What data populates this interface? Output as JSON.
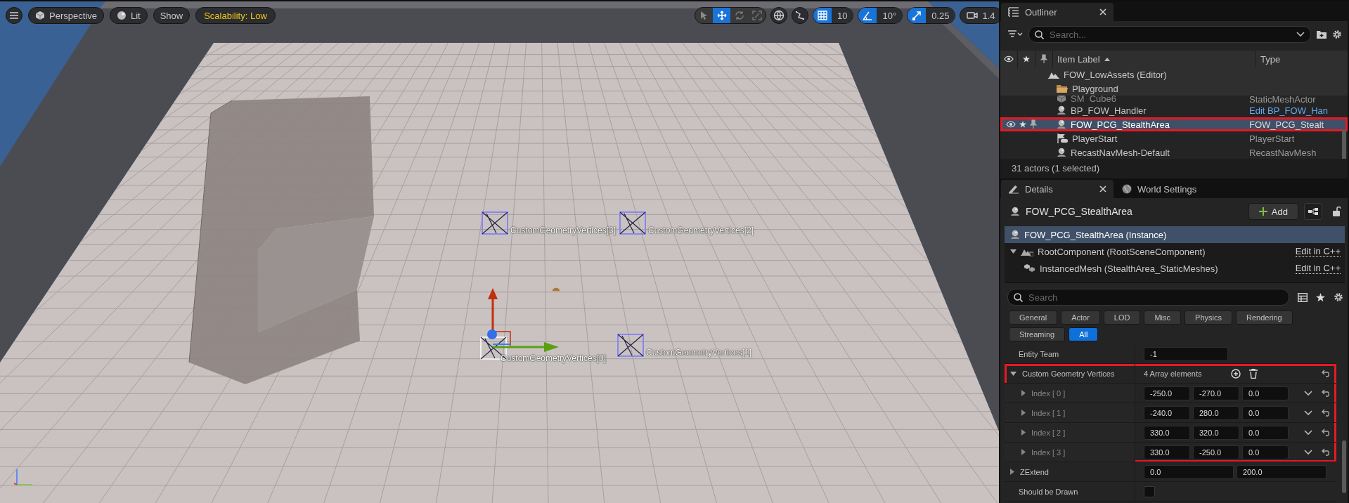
{
  "viewport": {
    "toolbar_left": [
      {
        "kind": "perspective",
        "label": "Perspective"
      },
      {
        "kind": "lit",
        "label": "Lit"
      },
      {
        "kind": "plain",
        "label": "Show"
      },
      {
        "kind": "warning",
        "label": "Scalability: Low"
      }
    ],
    "transform_tools": [
      {
        "kind": "select",
        "selected": false
      },
      {
        "kind": "move",
        "selected": true
      },
      {
        "kind": "rotate",
        "selected": false
      },
      {
        "kind": "scale",
        "selected": false
      }
    ],
    "snaps": [
      {
        "kind": "grid",
        "value": "10",
        "on": true
      },
      {
        "kind": "angle",
        "value": "10°",
        "on": true
      },
      {
        "kind": "scale",
        "value": "0.25",
        "on": true
      }
    ],
    "camera_speed": "1.4",
    "vertex_labels": [
      {
        "text": "CustomGeometryVertices[3]",
        "selected": false
      },
      {
        "text": "CustomGeometryVertices[2]",
        "selected": false
      },
      {
        "text": "CustomGeometryVertices[0]",
        "selected": true
      },
      {
        "text": "CustomGeometryVertices[1]",
        "selected": false
      }
    ]
  },
  "outliner": {
    "title": "Outliner",
    "search": {
      "placeholder": "Search..."
    },
    "columns": [
      "Item Label",
      "Type"
    ],
    "rows": [
      {
        "kind": "level",
        "label": "FOW_LowAssets (Editor)",
        "selected": false,
        "highlighted": false
      },
      {
        "kind": "folder",
        "label": "Playground",
        "selected": false,
        "highlighted": false
      },
      {
        "kind": "mesh",
        "label": "SM_Cube6",
        "type": "StaticMeshActor",
        "type_link": false,
        "selected": false,
        "highlighted": false
      },
      {
        "kind": "actor",
        "label": "BP_FOW_Handler",
        "type": "Edit BP_FOW_Han",
        "type_link": true,
        "selected": false,
        "highlighted": false
      },
      {
        "kind": "actor",
        "label": "FOW_PCG_StealthArea",
        "type": "FOW_PCG_Stealt",
        "type_link": false,
        "selected": true,
        "highlighted": true
      },
      {
        "kind": "playerstart",
        "label": "PlayerStart",
        "type": "PlayerStart",
        "type_link": false,
        "selected": false,
        "highlighted": false
      },
      {
        "kind": "actor",
        "label": "RecastNavMesh-Default",
        "type": "RecastNavMesh",
        "type_link": false,
        "selected": false,
        "highlighted": false
      }
    ],
    "status": "31 actors (1 selected)"
  },
  "details": {
    "tabs": [
      {
        "kind": "details",
        "label": "Details",
        "selected": true
      },
      {
        "kind": "world",
        "label": "World Settings",
        "selected": false
      }
    ],
    "actor_name": "FOW_PCG_StealthArea",
    "add_label": "Add",
    "components": [
      {
        "kind": "actor",
        "label": "FOW_PCG_StealthArea (Instance)",
        "selected": true
      },
      {
        "kind": "scene",
        "label": "RootComponent (RootSceneComponent)",
        "action": "Edit in C++",
        "selected": false,
        "expanded": true,
        "children": [
          {
            "kind": "mesh",
            "label": "InstancedMesh (StealthArea_StaticMeshes)",
            "action": "Edit in C++",
            "selected": false
          }
        ]
      }
    ],
    "search": {
      "placeholder": "Search"
    },
    "filters": [
      {
        "label": "General",
        "selected": false
      },
      {
        "label": "Actor",
        "selected": false
      },
      {
        "label": "LOD",
        "selected": false
      },
      {
        "label": "Misc",
        "selected": false
      },
      {
        "label": "Physics",
        "selected": false
      },
      {
        "label": "Rendering",
        "selected": false
      },
      {
        "label": "Streaming",
        "selected": false
      },
      {
        "label": "All",
        "selected": true
      }
    ],
    "properties": [
      {
        "kind": "number",
        "label": "Entity Team",
        "value": "-1"
      },
      {
        "kind": "array",
        "label": "Custom Geometry Vertices",
        "summary": "4 Array elements",
        "expanded": true,
        "highlighted": true,
        "children": [
          {
            "label": "Index [ 0 ]",
            "values": [
              "-250.0",
              "-270.0",
              "0.0"
            ]
          },
          {
            "label": "Index [ 1 ]",
            "values": [
              "-240.0",
              "280.0",
              "0.0"
            ]
          },
          {
            "label": "Index [ 2 ]",
            "values": [
              "330.0",
              "320.0",
              "0.0"
            ]
          },
          {
            "label": "Index [ 3 ]",
            "values": [
              "330.0",
              "-250.0",
              "0.0"
            ]
          }
        ]
      },
      {
        "kind": "range",
        "label": "ZExtend",
        "expanded": false,
        "values": [
          "0.0",
          "200.0"
        ]
      },
      {
        "kind": "bool",
        "label": "Should be Drawn",
        "checked": false
      }
    ]
  }
}
